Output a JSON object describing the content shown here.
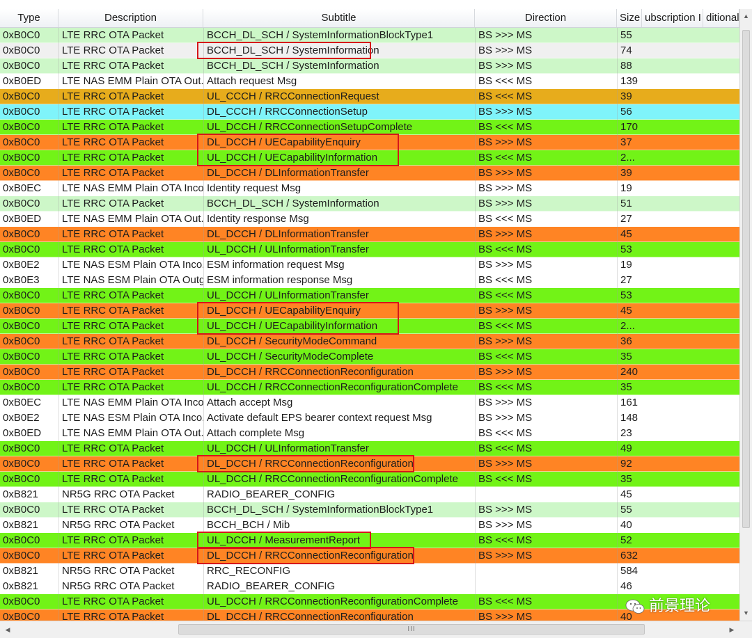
{
  "columns": [
    "Type",
    "Description",
    "Subtitle",
    "Direction",
    "Size",
    "ubscription I",
    "ditional"
  ],
  "colors": {
    "light_green": "#cdf7c8",
    "white": "#ffffff",
    "grey": "#f0f0f0",
    "gold": "#e7ac1c",
    "cyan": "#7ff4fa",
    "green": "#72f317",
    "orange": "#ff8424",
    "highlight": "#d6161a"
  },
  "rows": [
    {
      "type": "0xB0C0",
      "desc": "LTE RRC OTA Packet",
      "subtitle": "BCCH_DL_SCH / SystemInformationBlockType1",
      "dir": "BS >>> MS",
      "size": "55",
      "color": "light_green"
    },
    {
      "type": "0xB0C0",
      "desc": "LTE RRC OTA Packet",
      "subtitle": "BCCH_DL_SCH / SystemInformation",
      "dir": "BS >>> MS",
      "size": "74",
      "color": "grey"
    },
    {
      "type": "0xB0C0",
      "desc": "LTE RRC OTA Packet",
      "subtitle": "BCCH_DL_SCH / SystemInformation",
      "dir": "BS >>> MS",
      "size": "88",
      "color": "light_green"
    },
    {
      "type": "0xB0ED",
      "desc": "LTE NAS EMM Plain OTA Out...",
      "subtitle": "Attach request Msg",
      "dir": "BS <<< MS",
      "size": "139",
      "color": "white"
    },
    {
      "type": "0xB0C0",
      "desc": "LTE RRC OTA Packet",
      "subtitle": "UL_CCCH / RRCConnectionRequest",
      "dir": "BS <<< MS",
      "size": "39",
      "color": "gold"
    },
    {
      "type": "0xB0C0",
      "desc": "LTE RRC OTA Packet",
      "subtitle": "DL_CCCH / RRCConnectionSetup",
      "dir": "BS >>> MS",
      "size": "56",
      "color": "cyan"
    },
    {
      "type": "0xB0C0",
      "desc": "LTE RRC OTA Packet",
      "subtitle": "UL_DCCH / RRCConnectionSetupComplete",
      "dir": "BS <<< MS",
      "size": "170",
      "color": "green"
    },
    {
      "type": "0xB0C0",
      "desc": "LTE RRC OTA Packet",
      "subtitle": "DL_DCCH / UECapabilityEnquiry",
      "dir": "BS >>> MS",
      "size": "37",
      "color": "orange"
    },
    {
      "type": "0xB0C0",
      "desc": "LTE RRC OTA Packet",
      "subtitle": "UL_DCCH / UECapabilityInformation",
      "dir": "BS <<< MS",
      "size": "2...",
      "color": "green"
    },
    {
      "type": "0xB0C0",
      "desc": "LTE RRC OTA Packet",
      "subtitle": "DL_DCCH / DLInformationTransfer",
      "dir": "BS >>> MS",
      "size": "39",
      "color": "orange"
    },
    {
      "type": "0xB0EC",
      "desc": "LTE NAS EMM Plain OTA Inco...",
      "subtitle": "Identity request Msg",
      "dir": "BS >>> MS",
      "size": "19",
      "color": "white"
    },
    {
      "type": "0xB0C0",
      "desc": "LTE RRC OTA Packet",
      "subtitle": "BCCH_DL_SCH / SystemInformation",
      "dir": "BS >>> MS",
      "size": "51",
      "color": "light_green"
    },
    {
      "type": "0xB0ED",
      "desc": "LTE NAS EMM Plain OTA Out...",
      "subtitle": "Identity response Msg",
      "dir": "BS <<< MS",
      "size": "27",
      "color": "white"
    },
    {
      "type": "0xB0C0",
      "desc": "LTE RRC OTA Packet",
      "subtitle": "DL_DCCH / DLInformationTransfer",
      "dir": "BS >>> MS",
      "size": "45",
      "color": "orange"
    },
    {
      "type": "0xB0C0",
      "desc": "LTE RRC OTA Packet",
      "subtitle": "UL_DCCH / ULInformationTransfer",
      "dir": "BS <<< MS",
      "size": "53",
      "color": "green"
    },
    {
      "type": "0xB0E2",
      "desc": "LTE NAS ESM Plain OTA Inco...",
      "subtitle": "ESM information request Msg",
      "dir": "BS >>> MS",
      "size": "19",
      "color": "white"
    },
    {
      "type": "0xB0E3",
      "desc": "LTE NAS ESM Plain OTA Outg...",
      "subtitle": "ESM information response Msg",
      "dir": "BS <<< MS",
      "size": "27",
      "color": "white"
    },
    {
      "type": "0xB0C0",
      "desc": "LTE RRC OTA Packet",
      "subtitle": "UL_DCCH / ULInformationTransfer",
      "dir": "BS <<< MS",
      "size": "53",
      "color": "green"
    },
    {
      "type": "0xB0C0",
      "desc": "LTE RRC OTA Packet",
      "subtitle": "DL_DCCH / UECapabilityEnquiry",
      "dir": "BS >>> MS",
      "size": "45",
      "color": "orange"
    },
    {
      "type": "0xB0C0",
      "desc": "LTE RRC OTA Packet",
      "subtitle": "UL_DCCH / UECapabilityInformation",
      "dir": "BS <<< MS",
      "size": "2...",
      "color": "green"
    },
    {
      "type": "0xB0C0",
      "desc": "LTE RRC OTA Packet",
      "subtitle": "DL_DCCH / SecurityModeCommand",
      "dir": "BS >>> MS",
      "size": "36",
      "color": "orange"
    },
    {
      "type": "0xB0C0",
      "desc": "LTE RRC OTA Packet",
      "subtitle": "UL_DCCH / SecurityModeComplete",
      "dir": "BS <<< MS",
      "size": "35",
      "color": "green"
    },
    {
      "type": "0xB0C0",
      "desc": "LTE RRC OTA Packet",
      "subtitle": "DL_DCCH / RRCConnectionReconfiguration",
      "dir": "BS >>> MS",
      "size": "240",
      "color": "orange"
    },
    {
      "type": "0xB0C0",
      "desc": "LTE RRC OTA Packet",
      "subtitle": "UL_DCCH / RRCConnectionReconfigurationComplete",
      "dir": "BS <<< MS",
      "size": "35",
      "color": "green"
    },
    {
      "type": "0xB0EC",
      "desc": "LTE NAS EMM Plain OTA Inco...",
      "subtitle": "Attach accept Msg",
      "dir": "BS >>> MS",
      "size": "161",
      "color": "white"
    },
    {
      "type": "0xB0E2",
      "desc": "LTE NAS ESM Plain OTA Inco...",
      "subtitle": "Activate default EPS bearer context request Msg",
      "dir": "BS >>> MS",
      "size": "148",
      "color": "white"
    },
    {
      "type": "0xB0ED",
      "desc": "LTE NAS EMM Plain OTA Out...",
      "subtitle": "Attach complete Msg",
      "dir": "BS <<< MS",
      "size": "23",
      "color": "white"
    },
    {
      "type": "0xB0C0",
      "desc": "LTE RRC OTA Packet",
      "subtitle": "UL_DCCH / ULInformationTransfer",
      "dir": "BS <<< MS",
      "size": "49",
      "color": "green"
    },
    {
      "type": "0xB0C0",
      "desc": "LTE RRC OTA Packet",
      "subtitle": "DL_DCCH / RRCConnectionReconfiguration",
      "dir": "BS >>> MS",
      "size": "92",
      "color": "orange"
    },
    {
      "type": "0xB0C0",
      "desc": "LTE RRC OTA Packet",
      "subtitle": "UL_DCCH / RRCConnectionReconfigurationComplete",
      "dir": "BS <<< MS",
      "size": "35",
      "color": "green"
    },
    {
      "type": "0xB821",
      "desc": "NR5G RRC OTA Packet",
      "subtitle": "RADIO_BEARER_CONFIG",
      "dir": "",
      "size": "45",
      "color": "white"
    },
    {
      "type": "0xB0C0",
      "desc": "LTE RRC OTA Packet",
      "subtitle": "BCCH_DL_SCH / SystemInformationBlockType1",
      "dir": "BS >>> MS",
      "size": "55",
      "color": "light_green"
    },
    {
      "type": "0xB821",
      "desc": "NR5G RRC OTA Packet",
      "subtitle": "BCCH_BCH / Mib",
      "dir": "BS >>> MS",
      "size": "40",
      "color": "white"
    },
    {
      "type": "0xB0C0",
      "desc": "LTE RRC OTA Packet",
      "subtitle": "UL_DCCH / MeasurementReport",
      "dir": "BS <<< MS",
      "size": "52",
      "color": "green"
    },
    {
      "type": "0xB0C0",
      "desc": "LTE RRC OTA Packet",
      "subtitle": "DL_DCCH / RRCConnectionReconfiguration",
      "dir": "BS >>> MS",
      "size": "632",
      "color": "orange"
    },
    {
      "type": "0xB821",
      "desc": "NR5G RRC OTA Packet",
      "subtitle": "RRC_RECONFIG",
      "dir": "",
      "size": "584",
      "color": "white"
    },
    {
      "type": "0xB821",
      "desc": "NR5G RRC OTA Packet",
      "subtitle": "RADIO_BEARER_CONFIG",
      "dir": "",
      "size": "46",
      "color": "white"
    },
    {
      "type": "0xB0C0",
      "desc": "LTE RRC OTA Packet",
      "subtitle": "UL_DCCH / RRCConnectionReconfigurationComplete",
      "dir": "BS <<< MS",
      "size": "",
      "color": "green"
    },
    {
      "type": "0xB0C0",
      "desc": "LTE RRC OTA Packet",
      "subtitle": "DL_DCCH / RRCConnectionReconfiguration",
      "dir": "BS >>> MS",
      "size": "40",
      "color": "orange"
    }
  ],
  "highlights": [
    {
      "rows": [
        1,
        1
      ],
      "width": "single"
    },
    {
      "rows": [
        7,
        8
      ],
      "width": "pair"
    },
    {
      "rows": [
        18,
        19
      ],
      "width": "pair"
    },
    {
      "rows": [
        28,
        28
      ],
      "width": "long"
    },
    {
      "rows": [
        33,
        33
      ],
      "width": "single"
    },
    {
      "rows": [
        34,
        34
      ],
      "width": "long"
    }
  ],
  "scrollbar": {
    "grip": "III"
  },
  "watermark": {
    "text": "前景理论",
    "icon": "wechat-icon"
  }
}
